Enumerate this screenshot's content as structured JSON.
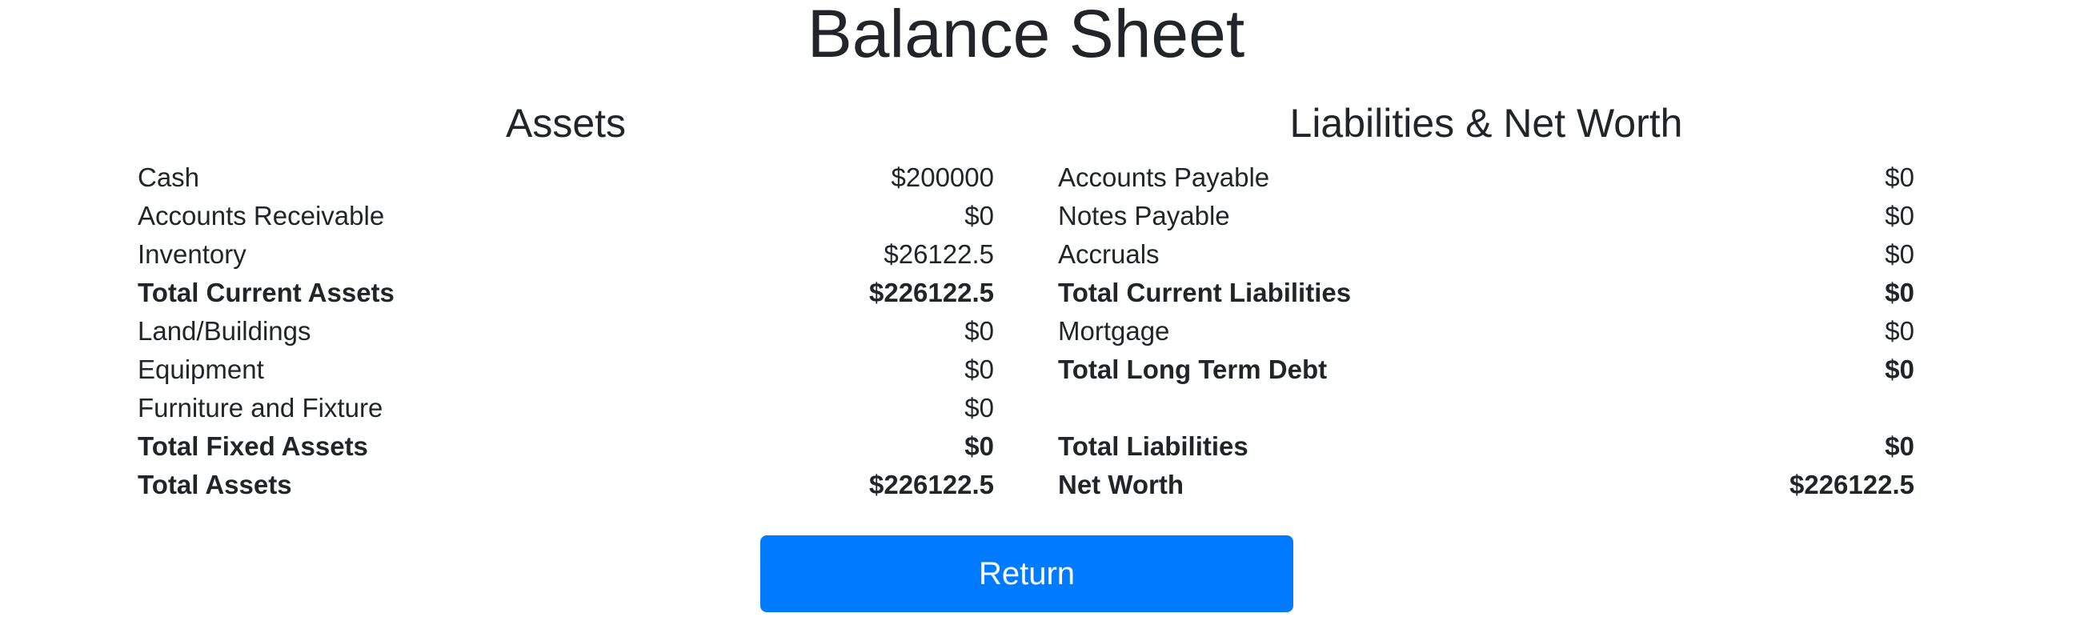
{
  "title": "Balance Sheet",
  "assets": {
    "heading": "Assets",
    "rows": [
      {
        "label": "Cash",
        "value": "$200000",
        "bold": false
      },
      {
        "label": "Accounts Receivable",
        "value": "$0",
        "bold": false
      },
      {
        "label": "Inventory",
        "value": "$26122.5",
        "bold": false
      },
      {
        "label": "Total Current Assets",
        "value": "$226122.5",
        "bold": true
      },
      {
        "label": "Land/Buildings",
        "value": "$0",
        "bold": false
      },
      {
        "label": "Equipment",
        "value": "$0",
        "bold": false
      },
      {
        "label": "Furniture and Fixture",
        "value": "$0",
        "bold": false
      },
      {
        "label": "Total Fixed Assets",
        "value": "$0",
        "bold": true
      },
      {
        "label": "Total Assets",
        "value": "$226122.5",
        "bold": true
      }
    ]
  },
  "liabilities": {
    "heading": "Liabilities & Net Worth",
    "rows": [
      {
        "label": "Accounts Payable",
        "value": "$0",
        "bold": false
      },
      {
        "label": "Notes Payable",
        "value": "$0",
        "bold": false
      },
      {
        "label": "Accruals",
        "value": "$0",
        "bold": false
      },
      {
        "label": "Total Current Liabilities",
        "value": "$0",
        "bold": true
      },
      {
        "label": "Mortgage",
        "value": "$0",
        "bold": false
      },
      {
        "label": "Total Long Term Debt",
        "value": "$0",
        "bold": true
      },
      {
        "label": "Total Liabilities",
        "value": "$0",
        "bold": true
      },
      {
        "label": "Net Worth",
        "value": "$226122.5",
        "bold": true
      }
    ]
  },
  "return_button": {
    "label": "Return"
  },
  "colors": {
    "button_bg": "#007bff",
    "button_text": "#ffffff",
    "text": "#212529"
  }
}
